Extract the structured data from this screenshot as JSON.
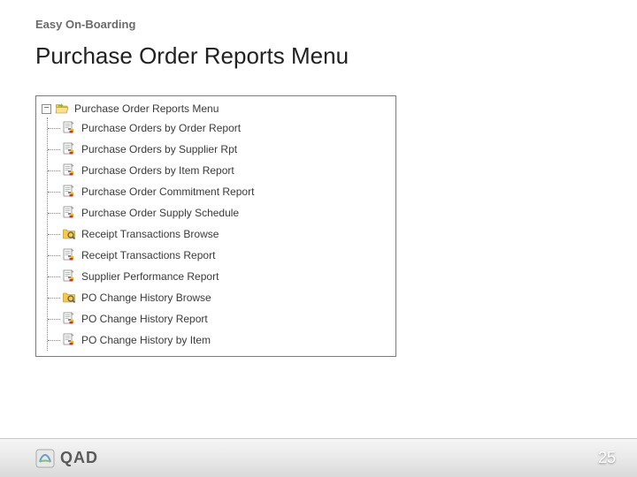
{
  "breadcrumb": "Easy On-Boarding",
  "title": "Purchase Order Reports Menu",
  "tree": {
    "root": {
      "label": "Purchase Order Reports Menu",
      "icon": "folder-open"
    },
    "children": [
      {
        "label": "Purchase Orders by Order Report",
        "icon": "report"
      },
      {
        "label": "Purchase Orders by Supplier Rpt",
        "icon": "report"
      },
      {
        "label": "Purchase Orders by Item Report",
        "icon": "report"
      },
      {
        "label": "Purchase Order Commitment Report",
        "icon": "report"
      },
      {
        "label": "Purchase Order Supply Schedule",
        "icon": "report"
      },
      {
        "label": "Receipt Transactions Browse",
        "icon": "browse"
      },
      {
        "label": "Receipt Transactions Report",
        "icon": "report"
      },
      {
        "label": "Supplier Performance Report",
        "icon": "report"
      },
      {
        "label": "PO Change History Browse",
        "icon": "browse"
      },
      {
        "label": "PO Change History Report",
        "icon": "report"
      },
      {
        "label": "PO Change History by Item",
        "icon": "report"
      }
    ]
  },
  "footer": {
    "logo_text": "QAD",
    "page": "25"
  }
}
